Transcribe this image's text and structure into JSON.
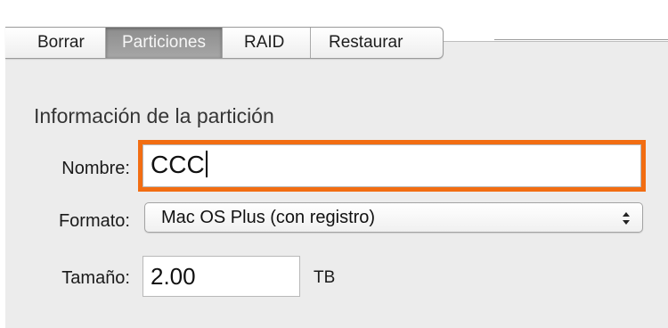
{
  "tabs": [
    {
      "label": "Borrar",
      "selected": false
    },
    {
      "label": "Particiones",
      "selected": true
    },
    {
      "label": "RAID",
      "selected": false
    },
    {
      "label": "Restaurar",
      "selected": false
    }
  ],
  "partition_info": {
    "title": "Información de la partición",
    "name": {
      "label": "Nombre:",
      "value": "CCC"
    },
    "format": {
      "label": "Formato:",
      "selected": "Mac OS Plus (con registro)"
    },
    "size": {
      "label": "Tamaño:",
      "value": "2.00",
      "unit": "TB"
    }
  },
  "colors": {
    "highlight": "#f26d12",
    "selected_tab": "#999999",
    "panel_background": "#ececec"
  },
  "icons": {
    "format_dropdown": "updown-arrows-icon"
  }
}
